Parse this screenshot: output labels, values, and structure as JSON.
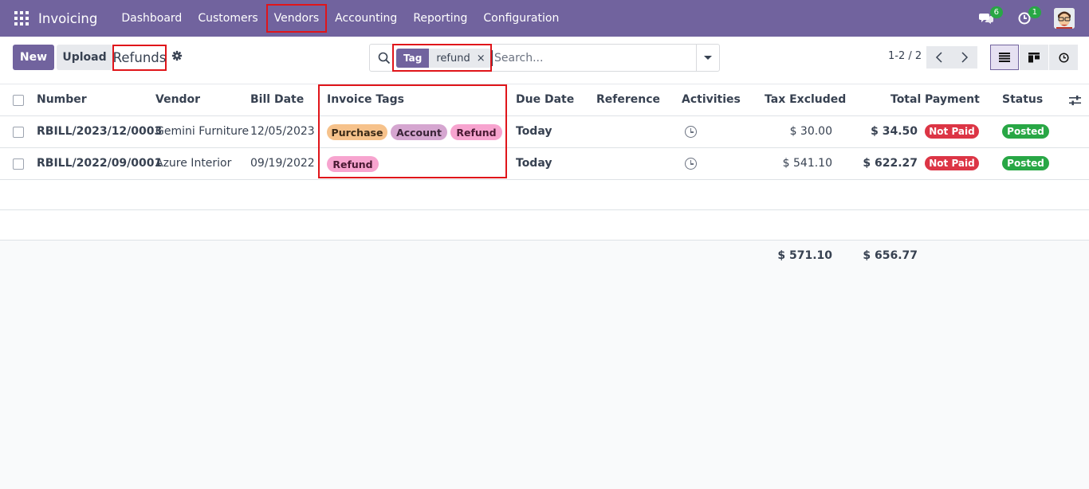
{
  "navbar": {
    "brand": "Invoicing",
    "menu": [
      {
        "label": "Dashboard",
        "active": false
      },
      {
        "label": "Customers",
        "active": false
      },
      {
        "label": "Vendors",
        "active": true
      },
      {
        "label": "Accounting",
        "active": false
      },
      {
        "label": "Reporting",
        "active": false
      },
      {
        "label": "Configuration",
        "active": false
      }
    ],
    "messages_count": "6",
    "activities_count": "1"
  },
  "control_panel": {
    "new_label": "New",
    "upload_label": "Upload",
    "title": "Refunds",
    "facet_label": "Tag",
    "facet_value": "refund",
    "facet_remove": "×",
    "search_placeholder": "Search...",
    "pager": "1-2 / 2"
  },
  "table": {
    "headers": {
      "number": "Number",
      "vendor": "Vendor",
      "bill_date": "Bill Date",
      "invoice_tags": "Invoice Tags",
      "due_date": "Due Date",
      "reference": "Reference",
      "activities": "Activities",
      "tax_excluded": "Tax Excluded",
      "total": "Total",
      "payment": "Payment",
      "status": "Status"
    },
    "rows": [
      {
        "number": "RBILL/2023/12/0003",
        "vendor": "Gemini Furniture",
        "bill_date": "12/05/2023",
        "tags": [
          "Purchase",
          "Account",
          "Refund"
        ],
        "due_date": "Today",
        "reference": "",
        "tax_excluded": "$ 30.00",
        "total": "$ 34.50",
        "payment": "Not Paid",
        "status": "Posted"
      },
      {
        "number": "RBILL/2022/09/0001",
        "vendor": "Azure Interior",
        "bill_date": "09/19/2022",
        "tags": [
          "Refund"
        ],
        "due_date": "Today",
        "reference": "",
        "tax_excluded": "$ 541.10",
        "total": "$ 622.27",
        "payment": "Not Paid",
        "status": "Posted"
      }
    ],
    "totals": {
      "tax_excluded": "$ 571.10",
      "total": "$ 656.77"
    }
  },
  "colors": {
    "brand": "#71639e",
    "highlight": "#e0151a",
    "tag_purchase": "#f6c28b",
    "tag_account": "#d5a6d0",
    "tag_refund": "#f7a4cf",
    "not_paid": "#dc3545",
    "posted": "#28a745",
    "today": "#a37305"
  }
}
